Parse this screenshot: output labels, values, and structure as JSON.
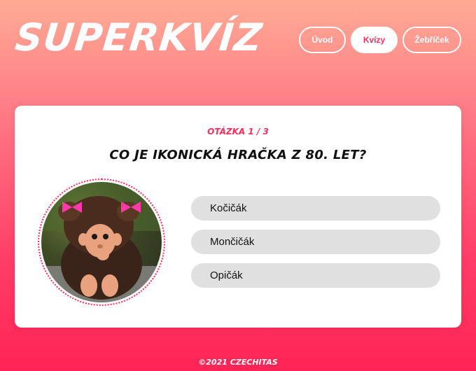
{
  "header": {
    "logo": "SUPERKVÍZ",
    "nav": [
      {
        "label": "Úvod",
        "active": false
      },
      {
        "label": "Kvízy",
        "active": true
      },
      {
        "label": "Žebříček",
        "active": false
      }
    ]
  },
  "quiz": {
    "counter": "Otázka 1 / 3",
    "question": "Co je ikonická hračka z 80. let?",
    "image_subject": "monchhichi-doll",
    "answers": [
      "Kočičák",
      "Mončičák",
      "Opičák"
    ]
  },
  "footer": {
    "text": "©2021 Czechitas"
  },
  "colors": {
    "accent": "#ff2d5c",
    "answer_bg": "#e0e0e0"
  }
}
